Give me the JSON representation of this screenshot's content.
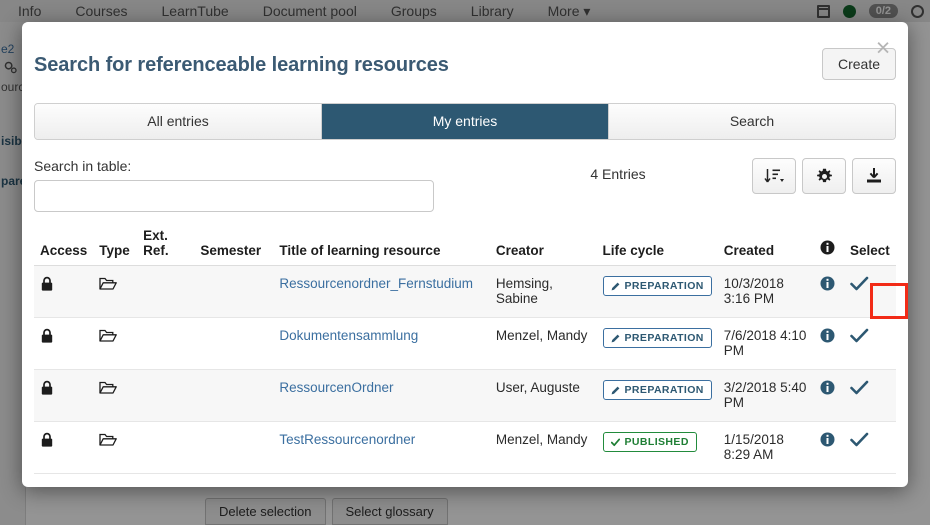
{
  "background": {
    "topnav": {
      "items": [
        "Info",
        "Courses",
        "LearnTube",
        "Document pool",
        "Groups",
        "Library",
        "More ▾"
      ],
      "badge_count": "0/2",
      "icons": [
        "calendar-icon",
        "status-dot-icon",
        "count-badge",
        "user-circle-icon"
      ]
    },
    "sidebar_fragments": [
      "e2",
      "ourc",
      "isib",
      "pare"
    ],
    "bottom_buttons": [
      "Delete selection",
      "Select glossary"
    ]
  },
  "modal": {
    "close_label": "×",
    "title": "Search for referenceable learning resources",
    "create_label": "Create",
    "tabs": [
      {
        "label": "All entries",
        "active": false
      },
      {
        "label": "My entries",
        "active": true
      },
      {
        "label": "Search",
        "active": false
      }
    ],
    "toolbar": {
      "search_label": "Search in table:",
      "search_value": "",
      "search_placeholder": "",
      "entries_count": "4 Entries",
      "buttons": [
        "sort-icon",
        "gear-icon",
        "download-icon"
      ]
    },
    "table": {
      "headers": {
        "access": "Access",
        "type": "Type",
        "ext_ref_line1": "Ext.",
        "ext_ref_line2": "Ref.",
        "semester": "Semester",
        "title": "Title of learning resource",
        "creator": "Creator",
        "life_cycle": "Life cycle",
        "created": "Created",
        "info": "info-icon",
        "select": "Select"
      },
      "rows": [
        {
          "access_icon": "lock-icon",
          "type_icon": "folder-open-icon",
          "ext_ref": "",
          "semester": "",
          "title": "Ressourcenordner_Fernstudium",
          "creator": "Hemsing, Sabine",
          "life_cycle": "PREPARATION",
          "life_cycle_state": "preparation",
          "created": "10/3/2018 3:16 PM",
          "info_icon": "info-icon",
          "select_icon": "check-icon",
          "highlighted": true
        },
        {
          "access_icon": "lock-icon",
          "type_icon": "folder-open-icon",
          "ext_ref": "",
          "semester": "",
          "title": "Dokumentensammlung",
          "creator": "Menzel, Mandy",
          "life_cycle": "PREPARATION",
          "life_cycle_state": "preparation",
          "created": "7/6/2018 4:10 PM",
          "info_icon": "info-icon",
          "select_icon": "check-icon",
          "highlighted": false
        },
        {
          "access_icon": "lock-icon",
          "type_icon": "folder-open-icon",
          "ext_ref": "",
          "semester": "",
          "title": "RessourcenOrdner",
          "creator": "User, Auguste",
          "life_cycle": "PREPARATION",
          "life_cycle_state": "preparation",
          "created": "3/2/2018 5:40 PM",
          "info_icon": "info-icon",
          "select_icon": "check-icon",
          "highlighted": false
        },
        {
          "access_icon": "lock-icon",
          "type_icon": "folder-open-icon",
          "ext_ref": "",
          "semester": "",
          "title": "TestRessourcenordner",
          "creator": "Menzel, Mandy",
          "life_cycle": "PUBLISHED",
          "life_cycle_state": "published",
          "created": "1/15/2018 8:29 AM",
          "info_icon": "info-icon",
          "select_icon": "check-icon",
          "highlighted": false
        }
      ]
    }
  },
  "colors": {
    "accent_blue": "#2d5872",
    "link_blue": "#3b6fa0",
    "published_green": "#1e7e34",
    "highlight_red": "#f22b17",
    "title_blue": "#3b5a73"
  }
}
